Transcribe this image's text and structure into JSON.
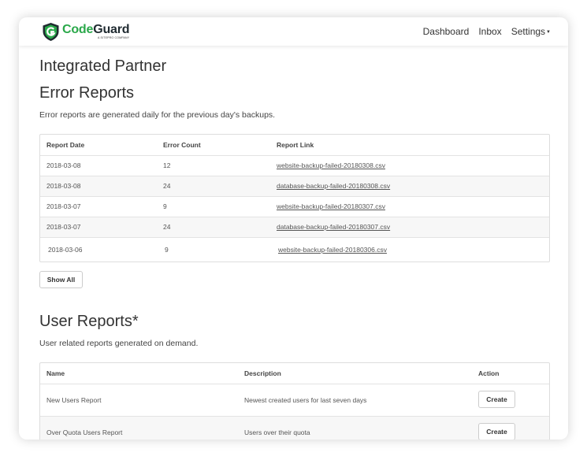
{
  "navbar": {
    "logo_code": "Code",
    "logo_guard": "Guard",
    "logo_tagline": "A SITEPRO COMPANY",
    "links": [
      "Dashboard",
      "Inbox",
      "Settings"
    ]
  },
  "page_title": "Integrated Partner",
  "error_reports": {
    "heading": "Error Reports",
    "description": "Error reports are generated daily for the previous day's backups.",
    "columns": [
      "Report Date",
      "Error Count",
      "Report Link"
    ],
    "rows": [
      {
        "date": "2018-03-08",
        "count": "12",
        "link": "website-backup-failed-20180308.csv"
      },
      {
        "date": "2018-03-08",
        "count": "24",
        "link": "database-backup-failed-20180308.csv"
      },
      {
        "date": "2018-03-07",
        "count": "9",
        "link": "website-backup-failed-20180307.csv"
      },
      {
        "date": "2018-03-07",
        "count": "24",
        "link": "database-backup-failed-20180307.csv"
      },
      {
        "date": "2018-03-06",
        "count": "9",
        "link": "website-backup-failed-20180306.csv"
      }
    ],
    "show_all_label": "Show All"
  },
  "user_reports": {
    "heading": "User Reports*",
    "description": "User related reports generated on demand.",
    "columns": [
      "Name",
      "Description",
      "Action"
    ],
    "rows": [
      {
        "name": "New Users Report",
        "description": "Newest created users for last seven days",
        "action": "Create"
      },
      {
        "name": "Over Quota Users Report",
        "description": "Users over their quota",
        "action": "Create"
      }
    ]
  },
  "colors": {
    "brand_green": "#2aa84a",
    "brand_dark": "#1f2a30"
  }
}
